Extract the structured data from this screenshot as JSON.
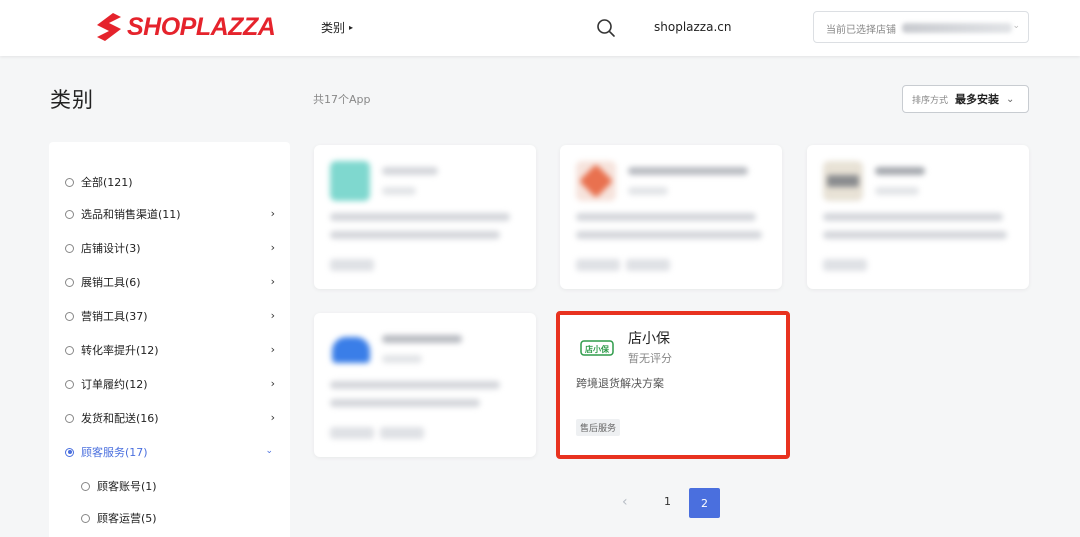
{
  "header": {
    "brand": "SHOPLAZZA",
    "nav_category": "类别",
    "domain": "shoplazza.cn",
    "store_select_label": "当前已选择店铺"
  },
  "page": {
    "title": "类别",
    "app_count": "共17个App",
    "sort_label": "排序方式",
    "sort_value": "最多安装"
  },
  "sidebar": {
    "items": [
      {
        "label": "全部(121)"
      },
      {
        "label": "选品和销售渠道(11)"
      },
      {
        "label": "店铺设计(3)"
      },
      {
        "label": "展销工具(6)"
      },
      {
        "label": "营销工具(37)"
      },
      {
        "label": "转化率提升(12)"
      },
      {
        "label": "订单履约(12)"
      },
      {
        "label": "发货和配送(16)"
      },
      {
        "label": "顾客服务(17)"
      }
    ],
    "sub_items": [
      {
        "label": "顾客账号(1)"
      },
      {
        "label": "顾客运营(5)"
      }
    ]
  },
  "featured_app": {
    "name": "店小保",
    "rating": "暂无评分",
    "description": "跨境退货解决方案",
    "tag": "售后服务",
    "logo_text": "店小保"
  },
  "pagination": {
    "page1": "1",
    "page2": "2",
    "current": 2
  },
  "colors": {
    "brand": "#e5232c",
    "accent": "#4a6fde",
    "highlight_border": "#e8321f"
  }
}
